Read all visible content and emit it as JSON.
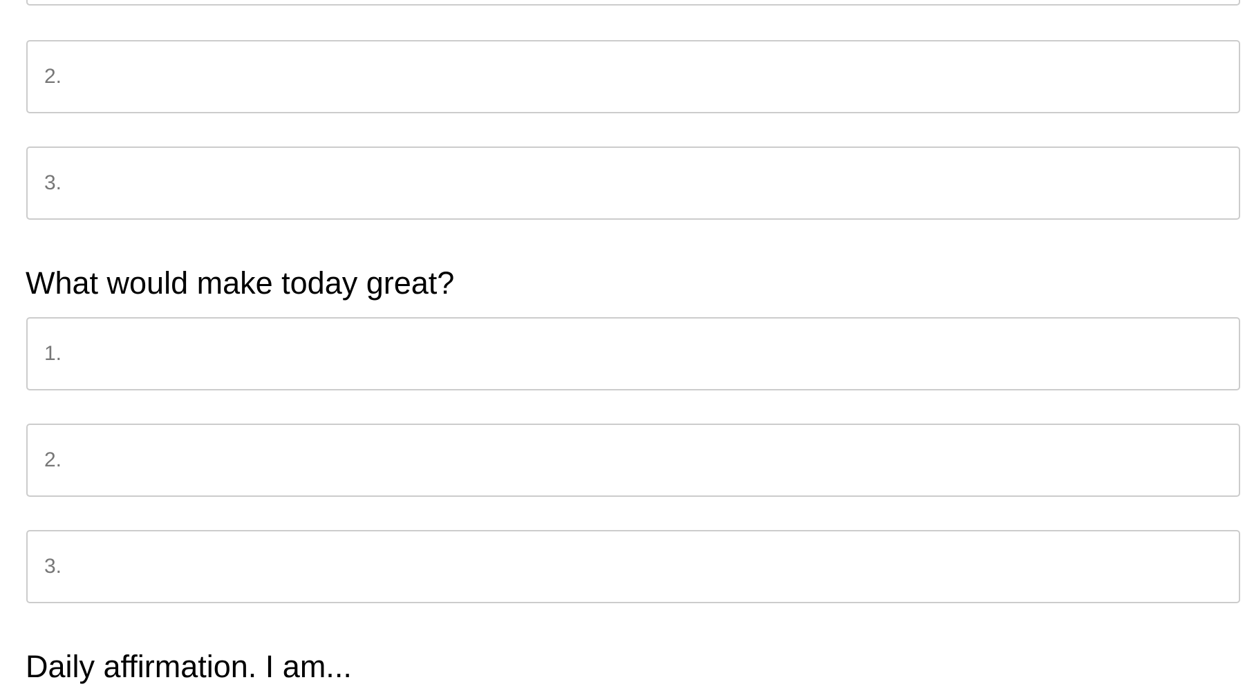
{
  "section_one": {
    "fields": [
      {
        "placeholder": "",
        "value": ""
      },
      {
        "placeholder": "2.",
        "value": ""
      },
      {
        "placeholder": "3.",
        "value": ""
      }
    ]
  },
  "section_two": {
    "heading": "What would make today great?",
    "fields": [
      {
        "placeholder": "1.",
        "value": ""
      },
      {
        "placeholder": "2.",
        "value": ""
      },
      {
        "placeholder": "3.",
        "value": ""
      }
    ]
  },
  "section_three": {
    "heading": "Daily affirmation. I am..."
  }
}
